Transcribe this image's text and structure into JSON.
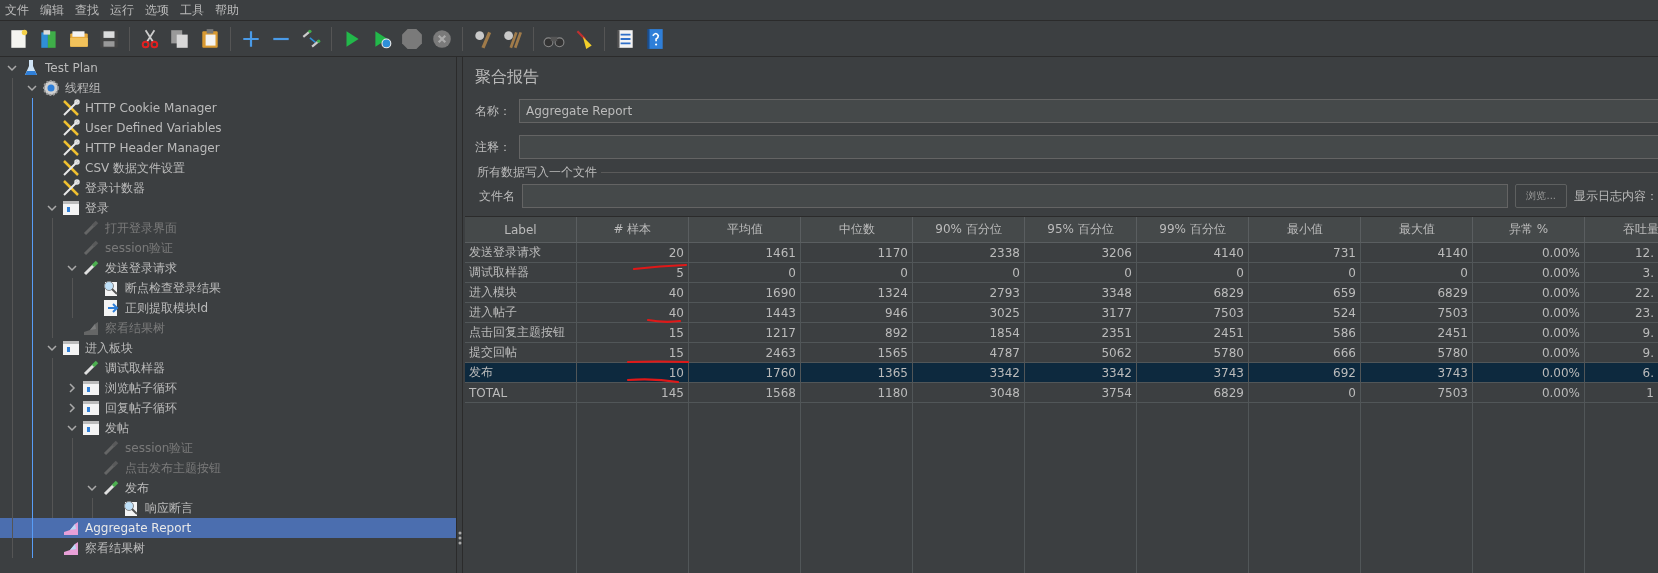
{
  "menu": [
    "文件",
    "编辑",
    "查找",
    "运行",
    "选项",
    "工具",
    "帮助"
  ],
  "tree": [
    {
      "label": "Test Plan",
      "kind": "plan",
      "expanded": true,
      "disabled": false,
      "selected": false,
      "children": [
        {
          "label": "线程组",
          "kind": "threads",
          "expanded": true,
          "disabled": false,
          "selected": false,
          "children": [
            {
              "label": "HTTP Cookie Manager",
              "kind": "config",
              "disabled": false,
              "selected": false
            },
            {
              "label": "User Defined Variables",
              "kind": "config",
              "disabled": false,
              "selected": false
            },
            {
              "label": "HTTP Header Manager",
              "kind": "config",
              "disabled": false,
              "selected": false
            },
            {
              "label": "CSV 数据文件设置",
              "kind": "config",
              "disabled": false,
              "selected": false
            },
            {
              "label": "登录计数器",
              "kind": "config",
              "disabled": false,
              "selected": false
            },
            {
              "label": "登录",
              "kind": "controller",
              "expanded": true,
              "disabled": false,
              "selected": false,
              "children": [
                {
                  "label": "打开登录界面",
                  "kind": "sampler",
                  "disabled": true,
                  "selected": false
                },
                {
                  "label": "session验证",
                  "kind": "sampler",
                  "disabled": true,
                  "selected": false
                },
                {
                  "label": "发送登录请求",
                  "kind": "sampler",
                  "expanded": true,
                  "disabled": false,
                  "selected": false,
                  "children": [
                    {
                      "label": "断点检查登录结果",
                      "kind": "assertion",
                      "disabled": false,
                      "selected": false
                    },
                    {
                      "label": "正则提取模块Id",
                      "kind": "extractor",
                      "disabled": false,
                      "selected": false
                    }
                  ]
                },
                {
                  "label": "察看结果树",
                  "kind": "listener",
                  "disabled": true,
                  "selected": false
                }
              ]
            },
            {
              "label": "进入板块",
              "kind": "controller",
              "expanded": true,
              "disabled": false,
              "selected": false,
              "children": [
                {
                  "label": "调试取样器",
                  "kind": "sampler",
                  "disabled": false,
                  "selected": false
                },
                {
                  "label": "浏览帖子循环",
                  "kind": "controller",
                  "expanded": false,
                  "disabled": false,
                  "selected": false
                },
                {
                  "label": "回复帖子循环",
                  "kind": "controller",
                  "expanded": false,
                  "disabled": false,
                  "selected": false
                },
                {
                  "label": "发帖",
                  "kind": "controller",
                  "expanded": true,
                  "disabled": false,
                  "selected": false,
                  "children": [
                    {
                      "label": "session验证",
                      "kind": "sampler",
                      "disabled": true,
                      "selected": false
                    },
                    {
                      "label": "点击发布主题按钮",
                      "kind": "sampler",
                      "disabled": true,
                      "selected": false
                    },
                    {
                      "label": "发布",
                      "kind": "sampler",
                      "expanded": true,
                      "disabled": false,
                      "selected": false,
                      "children": [
                        {
                          "label": "响应断言",
                          "kind": "assertion",
                          "disabled": false,
                          "selected": false
                        }
                      ]
                    }
                  ]
                }
              ]
            },
            {
              "label": "Aggregate Report",
              "kind": "listener",
              "disabled": false,
              "selected": true
            },
            {
              "label": "察看结果树",
              "kind": "listener",
              "disabled": false,
              "selected": false
            }
          ]
        }
      ]
    }
  ],
  "panel": {
    "title": "聚合报告",
    "name_label": "名称：",
    "name_value": "Aggregate Report",
    "comment_label": "注释：",
    "file_group": "所有数据写入一个文件",
    "file_label": "文件名",
    "browse_button": "浏览...",
    "log_label": "显示日志内容："
  },
  "table": {
    "columns": [
      "Label",
      "# 样本",
      "平均值",
      "中位数",
      "90% 百分位",
      "95% 百分位",
      "99% 百分位",
      "最小值",
      "最大值",
      "异常 %",
      "吞吐量"
    ],
    "rows": [
      {
        "cells": [
          "发送登录请求",
          "20",
          "1461",
          "1170",
          "2338",
          "3206",
          "4140",
          "731",
          "4140",
          "0.00%",
          "12."
        ],
        "selected": false,
        "marked": false
      },
      {
        "cells": [
          "调试取样器",
          "5",
          "0",
          "0",
          "0",
          "0",
          "0",
          "0",
          "0",
          "0.00%",
          "3."
        ],
        "selected": false,
        "marked": true
      },
      {
        "cells": [
          "进入模块",
          "40",
          "1690",
          "1324",
          "2793",
          "3348",
          "6829",
          "659",
          "6829",
          "0.00%",
          "22."
        ],
        "selected": false,
        "marked": false
      },
      {
        "cells": [
          "进入帖子",
          "40",
          "1443",
          "946",
          "3025",
          "3177",
          "7503",
          "524",
          "7503",
          "0.00%",
          "23."
        ],
        "selected": false,
        "marked": true
      },
      {
        "cells": [
          "点击回复主题按钮",
          "15",
          "1217",
          "892",
          "1854",
          "2351",
          "2451",
          "586",
          "2451",
          "0.00%",
          "9."
        ],
        "selected": false,
        "marked": false
      },
      {
        "cells": [
          "提交回帖",
          "15",
          "2463",
          "1565",
          "4787",
          "5062",
          "5780",
          "666",
          "5780",
          "0.00%",
          "9."
        ],
        "selected": false,
        "marked": true
      },
      {
        "cells": [
          "发布",
          "10",
          "1760",
          "1365",
          "3342",
          "3342",
          "3743",
          "692",
          "3743",
          "0.00%",
          "6."
        ],
        "selected": true,
        "marked": true
      },
      {
        "cells": [
          "TOTAL",
          "145",
          "1568",
          "1180",
          "3048",
          "3754",
          "6829",
          "0",
          "7503",
          "0.00%",
          "1"
        ],
        "selected": false,
        "marked": false
      }
    ]
  }
}
